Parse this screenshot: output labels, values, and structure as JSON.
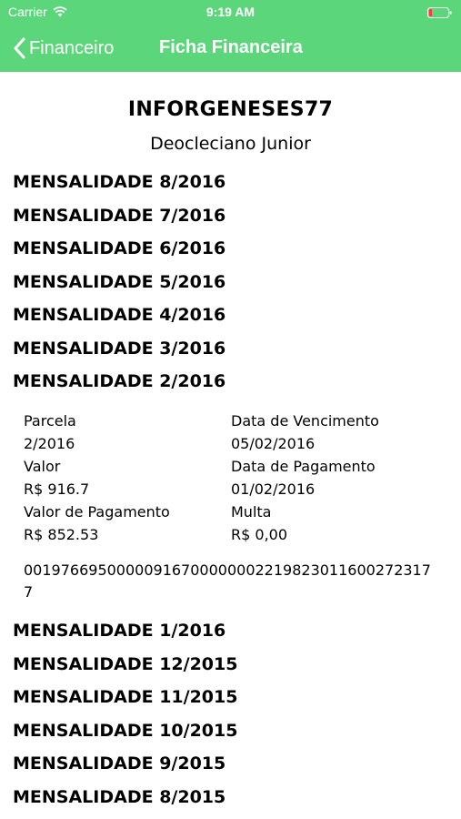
{
  "status_bar": {
    "carrier": "Carrier",
    "time": "9:19 AM"
  },
  "nav": {
    "back_label": "Financeiro",
    "title": "Ficha Financeira",
    "color": "#5cd67a"
  },
  "company": "INFORGENESES77",
  "user": "Deocleciano Junior",
  "months_before": [
    "MENSALIDADE 8/2016",
    "MENSALIDADE 7/2016",
    "MENSALIDADE 6/2016",
    "MENSALIDADE 5/2016",
    "MENSALIDADE 4/2016",
    "MENSALIDADE 3/2016",
    "MENSALIDADE 2/2016"
  ],
  "expanded": {
    "parcela_label": "Parcela",
    "parcela_value": "2/2016",
    "vencimento_label": "Data de Vencimento",
    "vencimento_value": "05/02/2016",
    "valor_label": "Valor",
    "valor_value": "R$ 916.7",
    "pagamento_label": "Data de Pagamento",
    "pagamento_value": "01/02/2016",
    "valor_pagamento_label": "Valor de Pagamento",
    "valor_pagamento_value": "R$ 852.53",
    "multa_label": "Multa",
    "multa_value": "R$ 0,00",
    "barcode": "001976695000009167000000022198230116002723177"
  },
  "months_after": [
    "MENSALIDADE 1/2016",
    "MENSALIDADE 12/2015",
    "MENSALIDADE 11/2015",
    "MENSALIDADE 10/2015",
    "MENSALIDADE 9/2015",
    "MENSALIDADE 8/2015"
  ]
}
